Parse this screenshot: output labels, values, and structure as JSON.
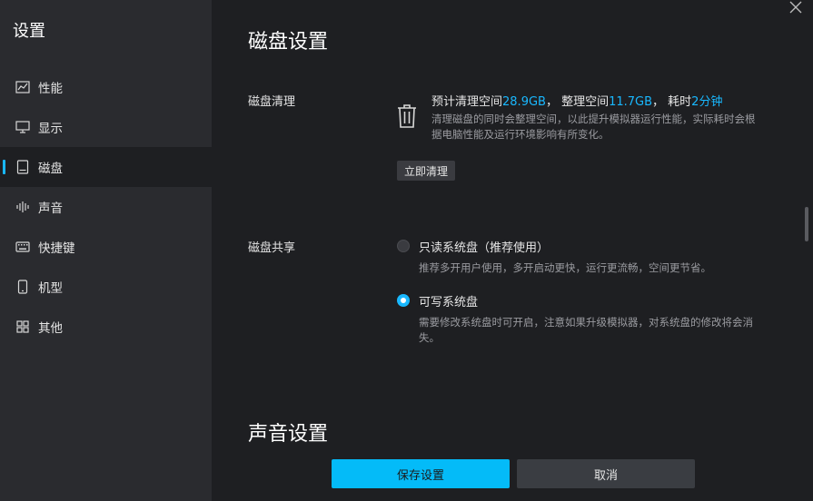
{
  "sidebar": {
    "title": "设置",
    "items": [
      {
        "label": "性能",
        "icon": "chart-line-icon"
      },
      {
        "label": "显示",
        "icon": "monitor-icon"
      },
      {
        "label": "磁盘",
        "icon": "disk-icon",
        "active": true
      },
      {
        "label": "声音",
        "icon": "sound-wave-icon"
      },
      {
        "label": "快捷键",
        "icon": "keyboard-icon"
      },
      {
        "label": "机型",
        "icon": "phone-icon"
      },
      {
        "label": "其他",
        "icon": "grid-icon"
      }
    ]
  },
  "disk": {
    "title": "磁盘设置",
    "cleanup": {
      "label": "磁盘清理",
      "estimate_prefix": "预计清理空间",
      "estimate_value": "28.9GB",
      "organize_prefix": "， 整理空间",
      "organize_value": "11.7GB",
      "time_prefix": "， 耗时",
      "time_value": "2分钟",
      "desc_line1": "清理磁盘的同时会整理空间，以此提升模拟器运行性能，实际耗时会根",
      "desc_line2": "据电脑性能及运行环境影响有所变化。",
      "button": "立即清理"
    },
    "share": {
      "label": "磁盘共享",
      "options": [
        {
          "label": "只读系统盘（推荐使用）",
          "desc_line1": "推荐多开用户使用，多开启动更快，运行更流畅，空间更节省。",
          "desc_line2": "",
          "selected": false
        },
        {
          "label": "可写系统盘",
          "desc_line1": "需要修改系统盘时可开启，注意如果升级模拟器，对系统盘的修改将会消",
          "desc_line2": "失。",
          "selected": true
        }
      ]
    }
  },
  "sound": {
    "title": "声音设置"
  },
  "footer": {
    "save": "保存设置",
    "cancel": "取消"
  },
  "colors": {
    "accent": "#19b8ff",
    "primary_button": "#04bbf8",
    "sidebar_bg": "#2a2b2f",
    "main_bg": "#1e1f22"
  }
}
